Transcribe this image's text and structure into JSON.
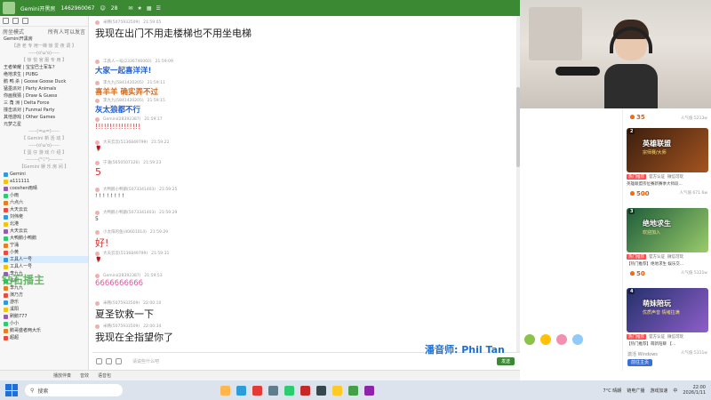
{
  "titlebar": {
    "channel_name": "Gemini开黑房",
    "room_id": "1462960067",
    "viewers": "28"
  },
  "sidebar": {
    "header_left": "房坐模式",
    "header_right": "所有人可以发言",
    "items": [
      "Gemini开黑房",
      "【游 老 专 用一梯 惊 爱 夜 调 】",
      "-----(o'ω'o)-----",
      "【 惊 悦 官 服 专 用 】",
      "王者荣耀 | 宝宝巴士军车?",
      "绝地求生 | PUBG",
      "鹅 鸭 杀 | Goose Goose Duck",
      "猛墨派对 | Party Animals",
      "你画我猜 | Draw & Guess",
      "三 角 洲 | Delta Force",
      "撞击派对 | Funmal Party",
      "其他游戏 | Other Games",
      "元梦之星",
      "-----(=ω=)-----",
      "【 Gemini 新 活 动 】",
      "-----(o'ω'o)-----",
      "【 蛋 仔 游 戏 介 绍 】",
      "--------(°▽°)--------",
      "【Gemini 娱 乐 房 间 】",
      "Gemini",
      "a111111",
      "cooshen雨晴",
      "小雨",
      "六点六",
      "大天云云",
      "刘伟佬",
      "北港",
      "大天云云",
      "大鸭鹅小鸭鹅",
      "宁涌",
      "小黄",
      "工具人一号",
      "工具人一号",
      "李九九",
      "本桐",
      "李九九",
      "演乃方",
      "游乐",
      "溪阳",
      "刷鹅777",
      "小小",
      "鹅哥盛者两大乐",
      "超超"
    ]
  },
  "chat": {
    "messages": [
      {
        "user": "米韩(5075933509)",
        "time": "21:59:05",
        "text": "我现在出门不用走楼梯也不用坐电梯",
        "style": "big"
      },
      {
        "user": "工具人一号(2336746060)",
        "time": "21:59:09",
        "text": "大家一起喜洋洋!",
        "style": "blue"
      },
      {
        "user": "李九九(5841420205)",
        "time": "21:59:11",
        "text": "喜羊羊  确实弄不过",
        "style": "orange"
      },
      {
        "user": "李九九(5841420205)",
        "time": "21:59:15",
        "text": "灰太狼都不行",
        "style": "blue"
      },
      {
        "user": "Gemini(28392387)",
        "time": "21:59:17",
        "text": "!!!!!!!!!!!!!!!!",
        "style": "red"
      },
      {
        "user": "大天云云(5136849799)",
        "time": "21:59:22",
        "text": "🌹",
        "style": "plain"
      },
      {
        "user": "宁涌(5650507126)",
        "time": "21:59:23",
        "text": "5",
        "style": "big-red"
      },
      {
        "user": "大鸭鹅小鸭鹅(5073341403)",
        "time": "21:59:25",
        "text": "! ! ! ! ! ! ! !",
        "style": "plain"
      },
      {
        "user": "大鸭鹅小鸭鹅(5073341403)",
        "time": "21:59:29",
        "text": "5",
        "style": "plain"
      },
      {
        "user": "小太阳的鱼(40601014)",
        "time": "21:59:29",
        "text": "好!",
        "style": "big-red"
      },
      {
        "user": "大天云云(5136849799)",
        "time": "21:59:31",
        "text": "🌹",
        "style": "plain"
      },
      {
        "user": "Gemini(28392387)",
        "time": "21:59:53",
        "text": "6666666666",
        "style": "pink"
      },
      {
        "user": "米韩(5075933509)",
        "time": "22:00:10",
        "text": "夏圣钦救一下",
        "style": "big"
      },
      {
        "user": "米韩(5075933509)",
        "time": "22:00:34",
        "text": "我现在全指望你了",
        "style": "big"
      }
    ],
    "input_placeholder": "请说些什么吧",
    "send_label": "发送"
  },
  "toolstrip": {
    "item1": "播放伴奏",
    "item2": "音效",
    "item3": "语音包"
  },
  "recommendations": [
    {
      "num": "",
      "price": "35",
      "popularity": "人气值 5213w",
      "title_line1": "",
      "title_line2": "",
      "tag1": "",
      "tag2": "",
      "tag3": "",
      "desc": ""
    },
    {
      "num": "2",
      "price": "500",
      "popularity": "人气值 671.6w",
      "title_line1": "英雄联盟",
      "title_line2": "宗师赛/大师",
      "tag1": "热门推荐",
      "tag2": "官方认证",
      "tag3": "微信可玩",
      "desc": "英雄联盟宗位赛新赛季大师段..."
    },
    {
      "num": "3",
      "price": "50",
      "popularity": "人气值 5121w",
      "title_line1": "绝地求生",
      "title_line2": "欢迎加入",
      "tag1": "热门推荐",
      "tag2": "官方认证",
      "tag3": "微信可玩",
      "desc": "【热门推荐】绝地求生 娱乐交..."
    },
    {
      "num": "4",
      "price": "",
      "popularity": "人气值 5311w",
      "title_line1": "萌妹陪玩",
      "title_line2": "优质声音 情绪拉满",
      "tag1": "热门推荐",
      "tag2": "官方认证",
      "tag3": "微信可玩",
      "desc": "【热门推荐】萌新陪聊 【..."
    }
  ],
  "overlays": {
    "credit": "潘音师: Phil Tan",
    "watermark": "钻石播主",
    "activate_line1": "激活 Windows",
    "activate_btn": "前往主页"
  },
  "taskbar": {
    "search": "搜索",
    "weather": "7°C 晴朗",
    "time": "22:00",
    "date": "2026/1/11",
    "lang": "中",
    "tray_text": "链电广播",
    "tray_text2": "游戏加速"
  },
  "colors": {
    "brand_green": "#3b8a33",
    "accent_blue": "#1a6fd6",
    "price_orange": "#e85a00"
  }
}
